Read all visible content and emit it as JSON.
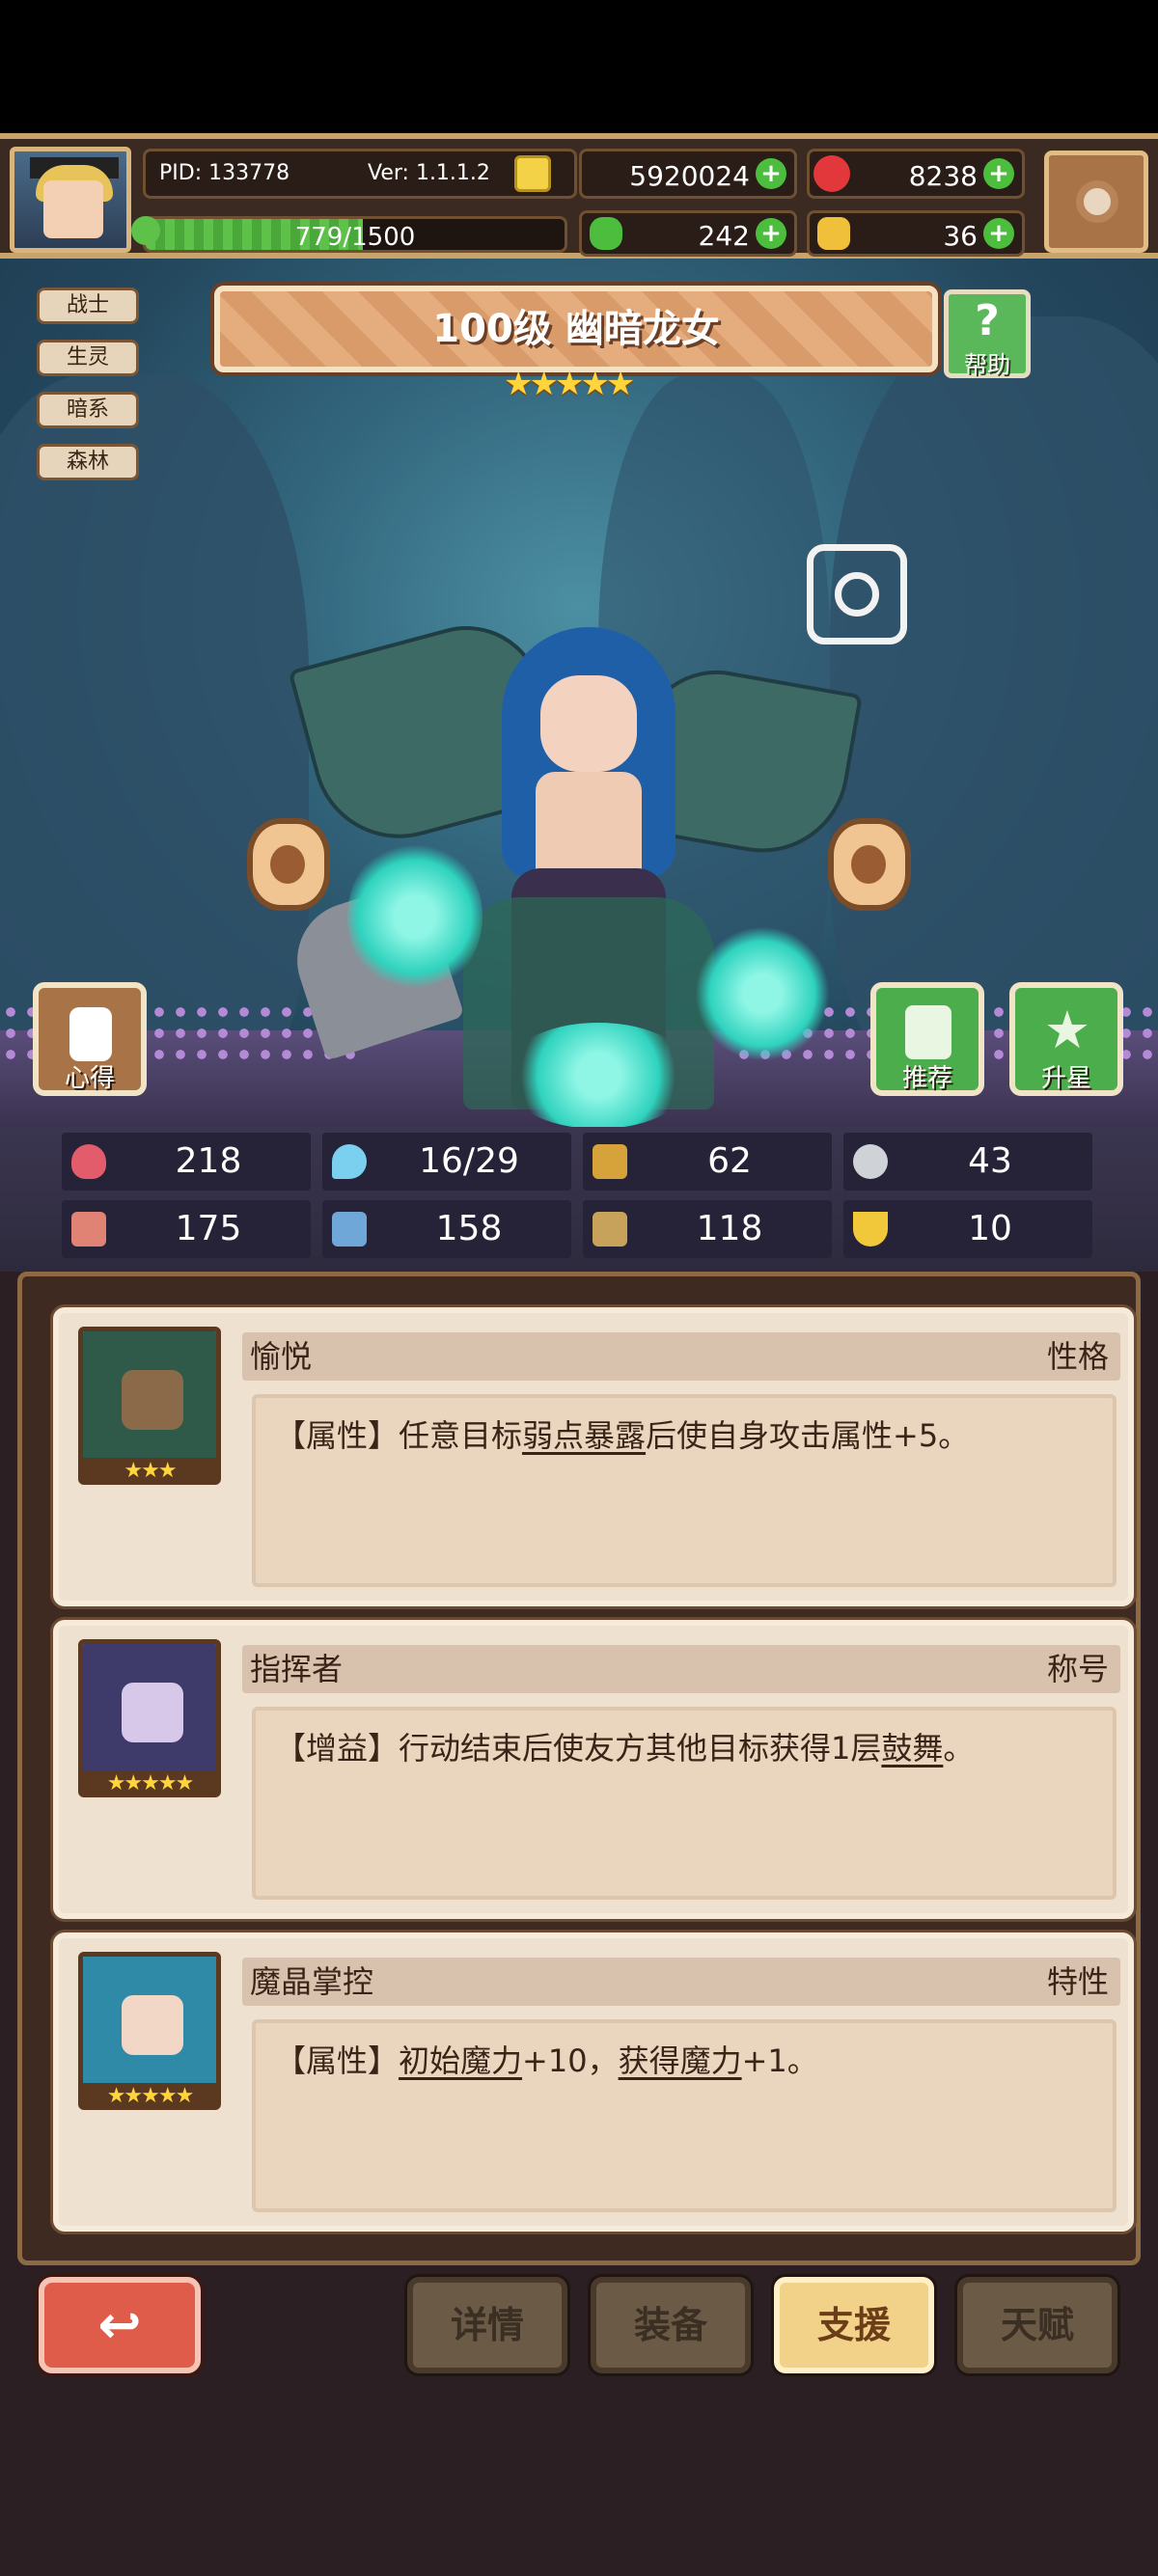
{
  "header": {
    "pid": "PID: 133778",
    "version": "Ver: 1.1.1.2",
    "gold": "5920024",
    "gems": "8238",
    "xp": "779/1500",
    "xp_progress": 0.519,
    "clover": "242",
    "shoe": "36"
  },
  "character": {
    "tags": [
      "战士",
      "生灵",
      "暗系",
      "森林"
    ],
    "title": "100级 幽暗龙女",
    "stars": "★★★★★",
    "help_label": "帮助",
    "left_btn_label": "心得",
    "recommend_label": "推荐",
    "star_up_label": "升星"
  },
  "stats": {
    "hp": "218",
    "mana": "16/29",
    "defense": "62",
    "speed": "43",
    "attack": "175",
    "magic": "158",
    "armor": "118",
    "luck": "10"
  },
  "cards": [
    {
      "name": "愉悦",
      "type": "性格",
      "stars": "★★★",
      "desc_pre": "【属性】任意目标",
      "desc_link": "弱点暴露",
      "desc_post": "后使自身攻击属性+5。"
    },
    {
      "name": "指挥者",
      "type": "称号",
      "stars": "★★★★★",
      "desc_pre": "【增益】行动结束后使友方其他目标获得1层",
      "desc_link": "鼓舞",
      "desc_post": "。"
    },
    {
      "name": "魔晶掌控",
      "type": "特性",
      "stars": "★★★★★",
      "desc_pre": "【属性】",
      "desc_link": "初始魔力",
      "desc_mid": "+10，",
      "desc_link2": "获得魔力",
      "desc_post": "+1。"
    }
  ],
  "bottom": {
    "back_icon": "↩",
    "tabs": [
      "详情",
      "装备",
      "支援",
      "天赋"
    ],
    "active_tab": "支援"
  },
  "colors": {
    "accent_green": "#4cbd3c",
    "gold_border": "#c9a36a",
    "active_tab": "#f2d189"
  }
}
